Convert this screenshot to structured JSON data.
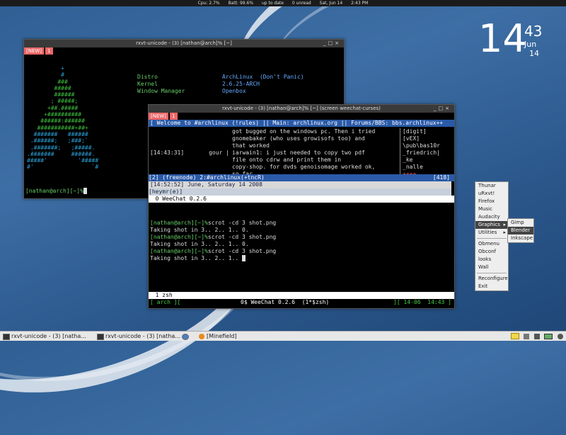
{
  "topbar": {
    "cpu": "Cpu: 2.7%",
    "batt": "Batt: 99.6%",
    "update": "up to date",
    "unread": "0 unread",
    "date": "Sat, Jun 14",
    "time": "2:43 PM"
  },
  "clock": {
    "hour": "14",
    "minute": "43",
    "month": "Jun",
    "day": "14"
  },
  "win1": {
    "title": "rxvt-unicode - (3) [nathan@arch]% [~]",
    "tab_new": "[NEW]",
    "tab_num": "1",
    "info_labels": [
      "Distro",
      "Kernel",
      "Window Manager"
    ],
    "info_values": [
      "ArchLinux  (Don't Panic)",
      "2.6.25-ARCH",
      "Openbox"
    ],
    "logo": [
      "          +",
      "          #",
      "         ###",
      "        #####",
      "        ######",
      "       ; #####;",
      "      +##.#####",
      "     +##########",
      "    ######:######",
      "   ###########+##+",
      "  #######   ######",
      " .######;   ;###;`",
      " .#######;   ;#####.",
      ".#######     ######.",
      "#####'         '#####",
      "#'                 `#"
    ],
    "prompt": "[nathan@arch][~]%"
  },
  "win2": {
    "title": "rxvt-unicode - (3) [nathan@arch]% [~] (screen weechat-curses)",
    "tab_new": "[NEW]",
    "tab_num": "1",
    "topic": "[ Welcome to #archlinux (!rules) || Main: archlinux.org || Forums/BBS: bbs.archlinux++",
    "chat": [
      {
        "t": "",
        "n": "",
        "m": "got bugged on the windows pc. Then i tried"
      },
      {
        "t": "",
        "n": "",
        "m": "gnomebaker (who uses growisofs too) and"
      },
      {
        "t": "",
        "n": "",
        "m": "that worked"
      },
      {
        "t": "[14:43:31]",
        "n": "gour |",
        "m": "iarwain1: i just needed to copy two pdf"
      },
      {
        "t": "",
        "n": "",
        "m": "file onto cdrw and print them in"
      },
      {
        "t": "",
        "n": "",
        "m": "copy-shop. for dvds genoisomage worked ok,"
      },
      {
        "t": "",
        "n": "",
        "m": "so far"
      }
    ],
    "nicks": [
      "[digit]",
      "[vEX]",
      "\\pub\\bas10r",
      "_friedrich|",
      "_ke",
      "_nalle",
      "++++"
    ],
    "status1": "[2] (freenode) 2:#archlinux(+tncR)",
    "status1_right": "[418]",
    "dateline": "[14:52:52] June, Saturday 14 2008",
    "input": "[heymr(e)]",
    "screen_line": "  0 WeeChat 0.2.6",
    "shell": [
      {
        "p": "[nathan@arch][~]%",
        "c": "scrot -cd 3 shot.png"
      },
      {
        "p": "",
        "c": "Taking shot in 3.. 2.. 1.. 0."
      },
      {
        "p": "[nathan@arch][~]%",
        "c": "scrot -cd 3 shot.png"
      },
      {
        "p": "",
        "c": "Taking shot in 3.. 2.. 1.. 0."
      },
      {
        "p": "[nathan@arch][~]%",
        "c": "scrot -cd 3 shot.png"
      },
      {
        "p": "",
        "c": "Taking shot in 3.. 2.. 1.. "
      }
    ],
    "screen_tab": "  1 zsh",
    "bottom_left": "[ arch ][",
    "bottom_mid": "0$ WeeChat 0.2.6  (1*$zsh)",
    "bottom_right": "][ 14-06  14:43 ]"
  },
  "menu": {
    "items": [
      "Thunar",
      "uRxvt!",
      "Firefox",
      "Music",
      "Audacity",
      "Graphics",
      "Utilities",
      "Obmenu",
      "Obconf",
      "looks",
      "Wall",
      "Reconfigure",
      "Exit"
    ],
    "submenu": [
      "Gimp",
      "Blender",
      "Inkscape"
    ]
  },
  "taskbar": {
    "tasks": [
      "rxvt-unicode - (3) [natha...",
      "rxvt-unicode - (3) [natha...",
      "[Minefield]"
    ]
  }
}
